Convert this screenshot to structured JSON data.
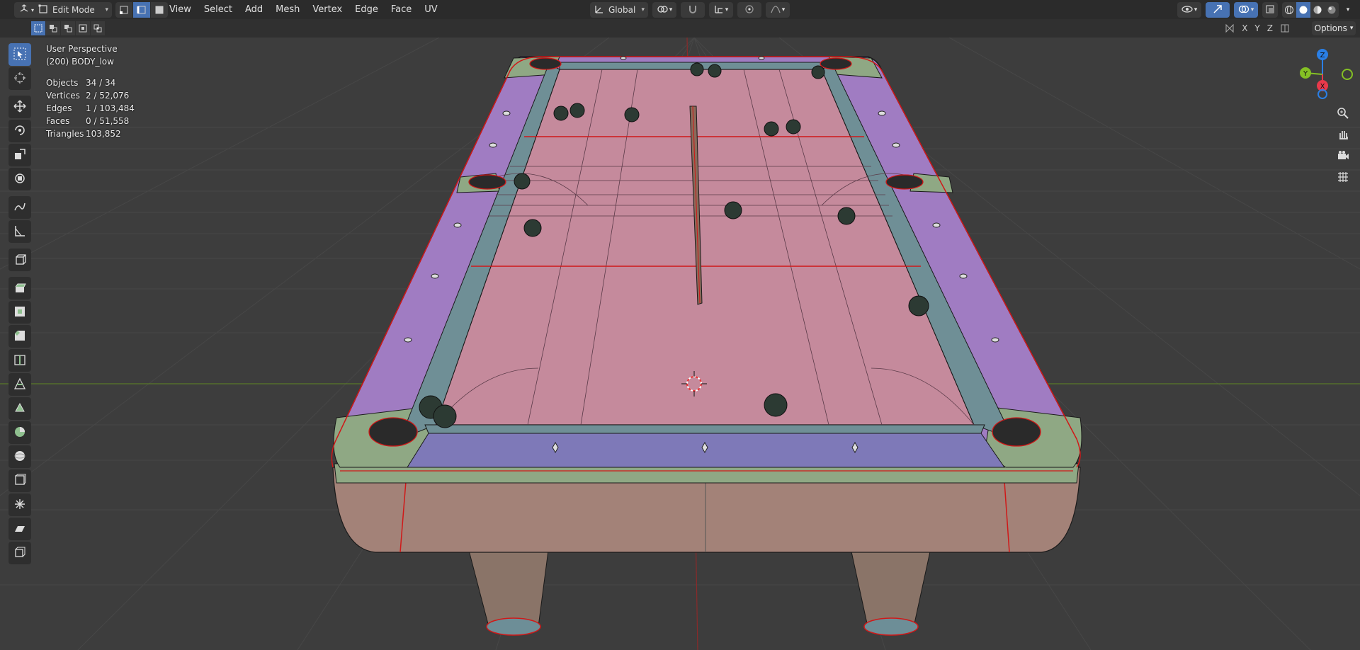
{
  "header": {
    "editor_type_icon": "3d-viewport-icon",
    "mode": "Edit Mode",
    "menus": [
      "View",
      "Select",
      "Add",
      "Mesh",
      "Vertex",
      "Edge",
      "Face",
      "UV"
    ],
    "transform_orientation": "Global"
  },
  "subbar": {
    "mirror_axes": [
      "X",
      "Y",
      "Z"
    ],
    "options_label": "Options"
  },
  "overlay": {
    "view_name": "User Perspective",
    "object_name": "(200) BODY_low",
    "stats": [
      {
        "label": "Objects",
        "value": "34 / 34"
      },
      {
        "label": "Vertices",
        "value": "2 / 52,076"
      },
      {
        "label": "Edges",
        "value": "1 / 103,484"
      },
      {
        "label": "Faces",
        "value": "0 / 51,558"
      },
      {
        "label": "Triangles",
        "value": "103,852"
      }
    ]
  },
  "gizmo": {
    "axes": [
      "Z",
      "Y",
      "X"
    ],
    "colors": {
      "x": "#e8394b",
      "y": "#84c024",
      "z": "#2a7fe6"
    }
  },
  "colors": {
    "accent": "#4772b3",
    "header_bg": "#2b2b2b",
    "viewport_bg": "#3d3d3d",
    "felt": "#c58a9c",
    "rail": "#a07cc2",
    "corner": "#8fa884",
    "apron": "#a38278",
    "edge_seam": "#d01818"
  }
}
